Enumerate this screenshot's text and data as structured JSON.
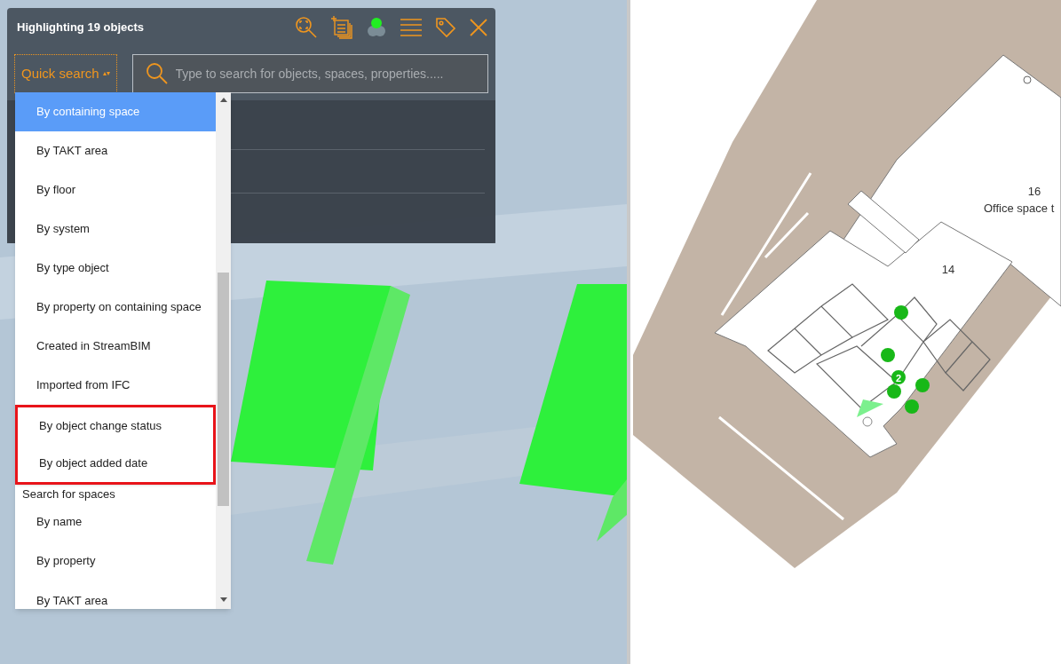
{
  "panel": {
    "title": "Highlighting 19 objects",
    "mode_select": {
      "label": "Quick search",
      "caret": "▴▾"
    },
    "search": {
      "placeholder": "Type to search for objects, spaces, properties....."
    }
  },
  "dropdown": {
    "items": [
      {
        "kind": "option",
        "label": "By containing space",
        "selected": true,
        "annotated": false
      },
      {
        "kind": "option",
        "label": "By TAKT area",
        "selected": false,
        "annotated": false
      },
      {
        "kind": "option",
        "label": "By floor",
        "selected": false,
        "annotated": false
      },
      {
        "kind": "option",
        "label": "By system",
        "selected": false,
        "annotated": false
      },
      {
        "kind": "option",
        "label": "By type object",
        "selected": false,
        "annotated": false
      },
      {
        "kind": "option",
        "label": "By property on containing space",
        "selected": false,
        "annotated": false
      },
      {
        "kind": "option",
        "label": "Created in StreamBIM",
        "selected": false,
        "annotated": false
      },
      {
        "kind": "option",
        "label": "Imported from IFC",
        "selected": false,
        "annotated": false
      },
      {
        "kind": "option",
        "label": "By object change status",
        "selected": false,
        "annotated": true
      },
      {
        "kind": "option",
        "label": "By object added date",
        "selected": false,
        "annotated": true
      },
      {
        "kind": "group",
        "label": "Search for spaces"
      },
      {
        "kind": "option",
        "label": "By name",
        "selected": false,
        "annotated": false
      },
      {
        "kind": "option",
        "label": "By property",
        "selected": false,
        "annotated": false
      },
      {
        "kind": "option",
        "label": "By TAKT area",
        "selected": false,
        "annotated": false
      }
    ]
  },
  "floor_plan": {
    "rooms": [
      {
        "number": "16",
        "name": "Office space t"
      },
      {
        "number": "14"
      }
    ],
    "cluster_count": "2"
  }
}
